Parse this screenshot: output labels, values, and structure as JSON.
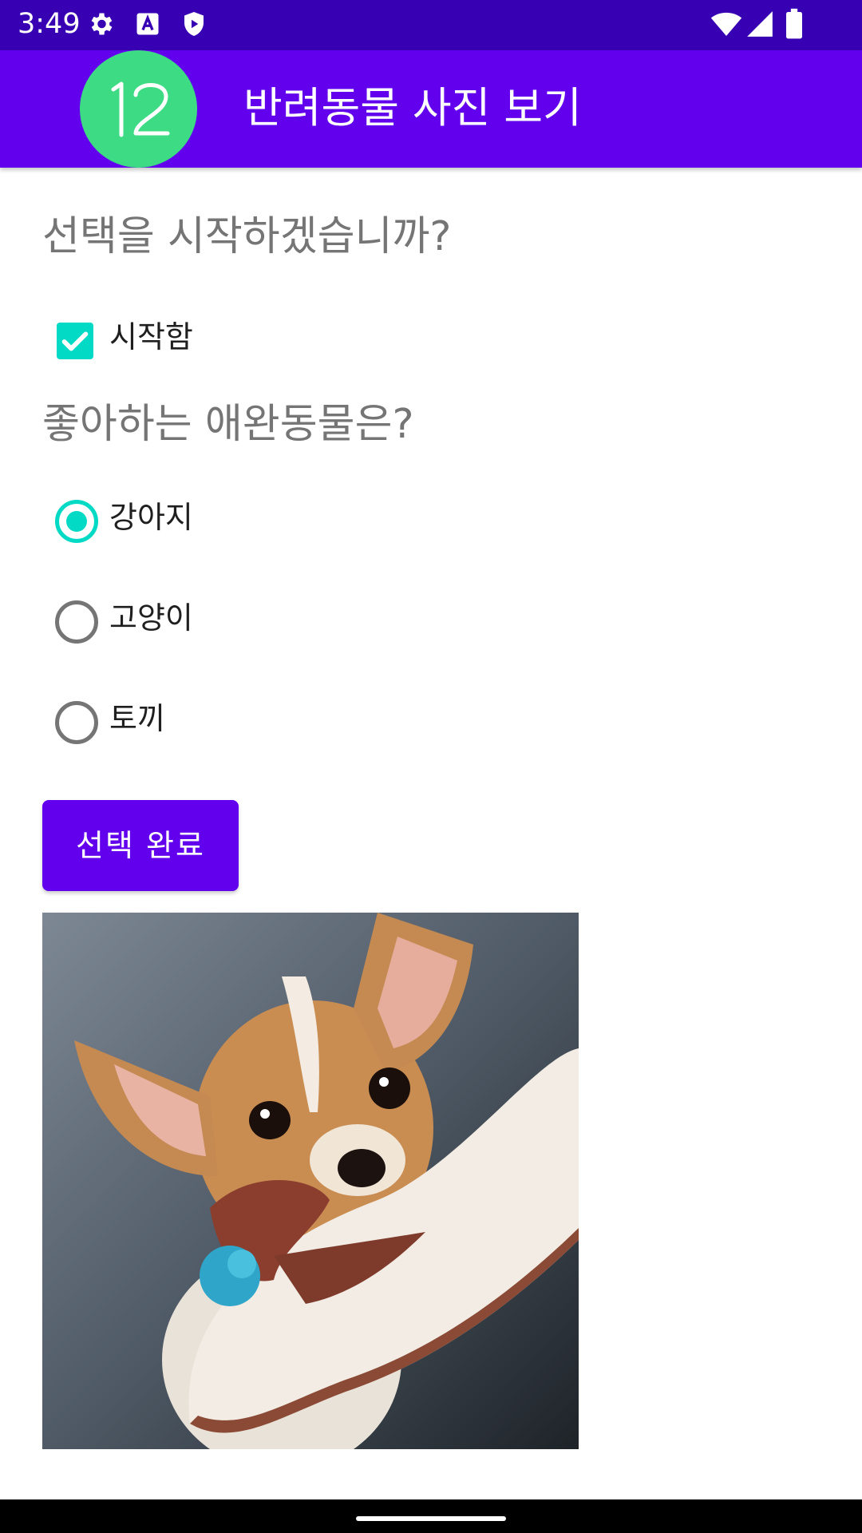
{
  "status_bar": {
    "time": "3:49",
    "left_icons": [
      "gear-icon",
      "a-icon",
      "play-shield-icon"
    ],
    "right_icons": [
      "wifi-icon",
      "signal-icon",
      "battery-icon"
    ]
  },
  "app_bar": {
    "logo_text": "12",
    "title": "반려동물 사진 보기"
  },
  "colors": {
    "status_bar": "#3700b3",
    "primary": "#6200ee",
    "accent": "#03dac5",
    "logo": "#3ddc84",
    "question_text": "#757575"
  },
  "start_section": {
    "question": "선택을 시작하겠습니까?",
    "checkbox_label": "시작함",
    "checked": true
  },
  "pet_section": {
    "question": "좋아하는 애완동물은?",
    "options": [
      {
        "label": "강아지",
        "selected": true
      },
      {
        "label": "고양이",
        "selected": false
      },
      {
        "label": "토끼",
        "selected": false
      }
    ]
  },
  "done_button": {
    "label": "선택 완료"
  },
  "photo": {
    "subject": "chihuahua puppy chewing a slipper"
  }
}
